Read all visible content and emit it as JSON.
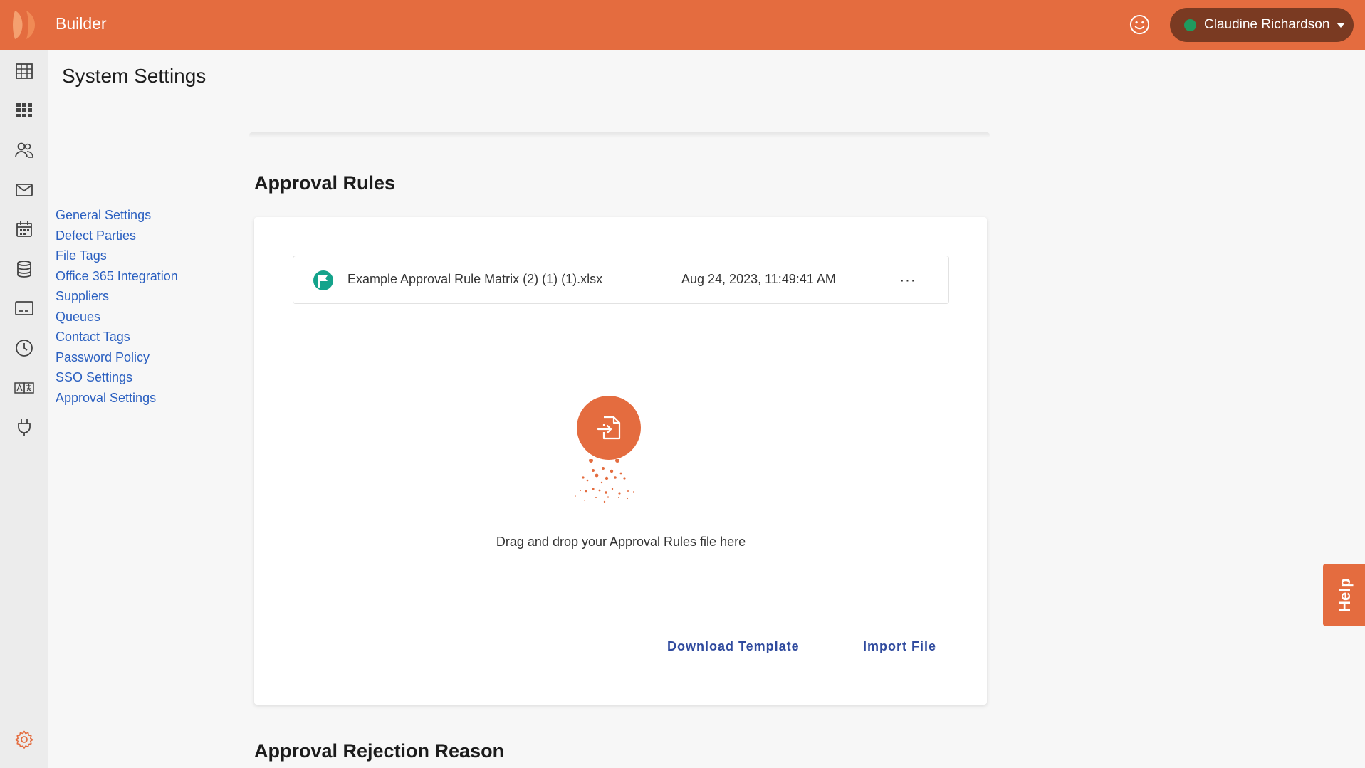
{
  "app": {
    "title": "Builder",
    "accent": "#e46c3f"
  },
  "header": {
    "user_name": "Claudine Richardson",
    "status_color": "#1f9a5e",
    "icons": [
      "logo-icon",
      "smiley-icon",
      "chevron-down-icon"
    ]
  },
  "rail": {
    "icons": [
      "table-icon",
      "grid-icon",
      "users-icon",
      "mail-icon",
      "calendar-icon",
      "database-icon",
      "terminal-icon",
      "clock-icon",
      "translate-icon",
      "plug-icon",
      "gear-icon"
    ]
  },
  "page": {
    "title": "System Settings"
  },
  "settings_nav": {
    "items": [
      {
        "label": "General Settings"
      },
      {
        "label": "Defect Parties"
      },
      {
        "label": "File Tags"
      },
      {
        "label": "Office 365 Integration"
      },
      {
        "label": "Suppliers"
      },
      {
        "label": "Queues"
      },
      {
        "label": "Contact Tags"
      },
      {
        "label": "Password Policy"
      },
      {
        "label": "SSO Settings"
      },
      {
        "label": "Approval Settings"
      }
    ]
  },
  "approval_rules": {
    "title": "Approval Rules",
    "file": {
      "name": "Example Approval Rule Matrix (2) (1) (1).xlsx",
      "date": "Aug 24, 2023, 11:49:41 AM",
      "more_label": "···"
    },
    "drop_text": "Drag and drop your Approval Rules file here",
    "download_label": "Download Template",
    "import_label": "Import File"
  },
  "rejection": {
    "title": "Approval Rejection Reason"
  },
  "help": {
    "label": "Help"
  }
}
